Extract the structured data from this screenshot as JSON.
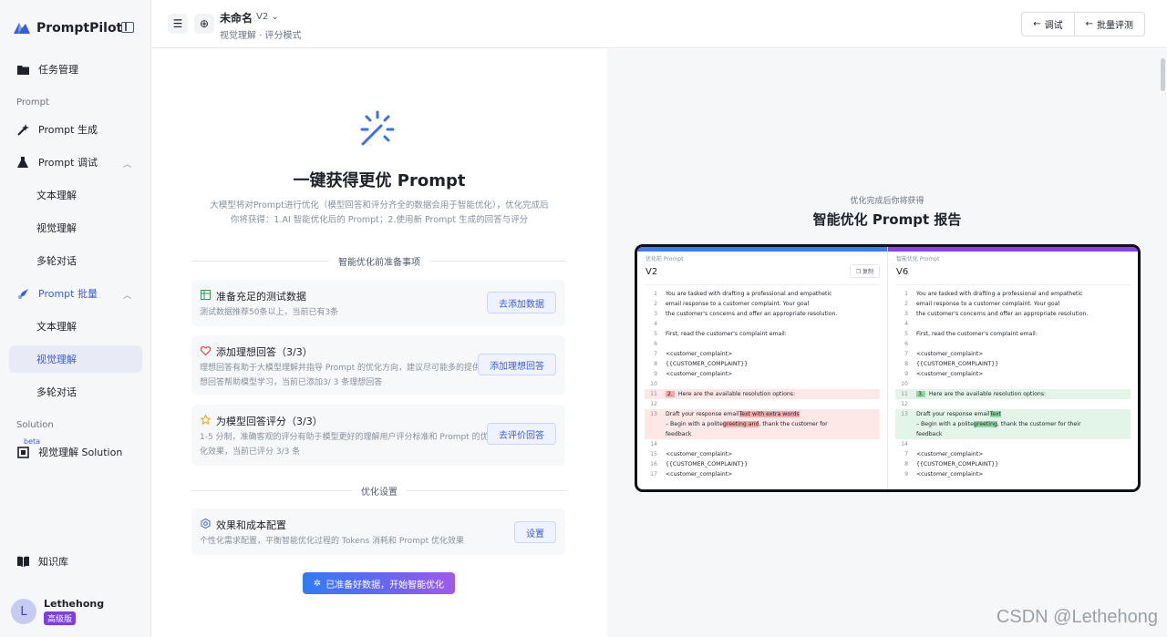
{
  "app": {
    "name": "PromptPilot"
  },
  "sidebar": {
    "task_mgmt": "任务管理",
    "section_prompt": "Prompt",
    "prompt_gen": "Prompt 生成",
    "prompt_debug": "Prompt 调试",
    "debug_subs": [
      "文本理解",
      "视觉理解",
      "多轮对话"
    ],
    "prompt_batch": "Prompt 批量",
    "batch_subs": [
      "文本理解",
      "视觉理解",
      "多轮对话"
    ],
    "section_solution": "Solution",
    "beta": "beta",
    "vision_solution": "视觉理解 Solution",
    "knowledge": "知识库",
    "user": {
      "initial": "L",
      "name": "Lethehong",
      "tier": "高级版"
    }
  },
  "header": {
    "title": "未命名",
    "version": "V2 ⌄",
    "breadcrumb_a": "视觉理解",
    "breadcrumb_sep": " · ",
    "breadcrumb_b": "评分模式",
    "debug_btn": "调试",
    "batch_eval_btn": "批量评测"
  },
  "left": {
    "title": "一键获得更优 Prompt",
    "desc": "大模型将对Prompt进行优化（模型回答和评分齐全的数据会用于智能优化），优化完成后你将获得：1.AI 智能优化后的 Prompt；2.使用新 Prompt 生成的回答与评分",
    "prep_label": "智能优化前准备事项",
    "cards": [
      {
        "title": "准备充足的测试数据",
        "desc": "测试数据推荐50条以上，当前已有3条",
        "btn": "去添加数据"
      },
      {
        "title": "添加理想回答（3/3）",
        "desc": "理想回答有助于大模型理解并指导 Prompt 的优化方向，建议尽可能多的提供理想回答帮助模型学习，当前已添加3/ 3 条理想回答",
        "btn": "添加理想回答"
      },
      {
        "title": "为模型回答评分（3/3）",
        "desc": "1-5 分制，准确客观的评分有助于模型更好的理解用户评分标准和 Prompt 的优化效果，当前已评分 3/3 条",
        "btn": "去评价回答"
      }
    ],
    "opt_label": "优化设置",
    "config": {
      "title": "效果和成本配置",
      "desc": "个性化需求配置，平衡智能优化过程的 Tokens 消耗和 Prompt 优化效果",
      "btn": "设置"
    },
    "start_btn": "已准备好数据，开始智能优化"
  },
  "right": {
    "subtitle": "优化完成后你将获得",
    "title": "智能优化 Prompt 报告",
    "left_pane": {
      "head": "优化前 Prompt",
      "version": "V2",
      "copy": "复制"
    },
    "right_pane": {
      "head": "智能优化 Prompt",
      "version": "V6"
    },
    "left_lines": [
      {
        "n": "1",
        "t": "You are tasked with drafting a professional and empathetic"
      },
      {
        "n": "2",
        "t": "email response to a customer complaint. Your goal"
      },
      {
        "n": "3",
        "t": "the customer's concerns and offer an appropriate resolution."
      },
      {
        "n": "4",
        "t": ""
      },
      {
        "n": "5",
        "t": "First, read the customer's complaint email:"
      },
      {
        "n": "6",
        "t": ""
      },
      {
        "n": "7",
        "t": "<customer_complaint>"
      },
      {
        "n": "8",
        "t": "{{CUSTOMER_COMPLAINT}}"
      },
      {
        "n": "9",
        "t": "<customer_complaint>"
      },
      {
        "n": "10",
        "t": ""
      },
      {
        "n": "11",
        "mark": "2.",
        "t": "Here are the available resolution options:",
        "cls": "del"
      },
      {
        "n": "12",
        "t": ""
      },
      {
        "n": "13",
        "pre": "Draft your response email",
        "hl": "Text with extra words",
        "post": "",
        "cls": "del"
      },
      {
        "n": "",
        "pre": "– Begin with a polite",
        "hl": "greeting and",
        "post": ", thank the customer for",
        "cls": "del"
      },
      {
        "n": "",
        "t": "feedback",
        "cls": "del"
      },
      {
        "n": "14",
        "t": ""
      },
      {
        "n": "15",
        "t": "<customer_complaint>"
      },
      {
        "n": "16",
        "t": "{{CUSTOMER_COMPLAINT}}"
      },
      {
        "n": "17",
        "t": "<customer_complaint>"
      }
    ],
    "right_lines": [
      {
        "n": "1",
        "t": "You are tasked with drafting a professional and empathetic"
      },
      {
        "n": "2",
        "t": "email response to a customer complaint. Your goal"
      },
      {
        "n": "3",
        "t": "the customer's concerns and offer an appropriate resolution."
      },
      {
        "n": "4",
        "t": ""
      },
      {
        "n": "5",
        "t": "First, read the customer's complaint email:"
      },
      {
        "n": "6",
        "t": ""
      },
      {
        "n": "7",
        "t": "<customer_complaint>"
      },
      {
        "n": "8",
        "t": "{{CUSTOMER_COMPLAINT}}"
      },
      {
        "n": "9",
        "t": "<customer_complaint>"
      },
      {
        "n": "10",
        "t": ""
      },
      {
        "n": "11",
        "mark": "3.",
        "t": "Here are the available resolution options:",
        "cls": "add"
      },
      {
        "n": "12",
        "t": ""
      },
      {
        "n": "13",
        "pre": "Draft your response email",
        "hl": "Text",
        "post": "",
        "cls": "add"
      },
      {
        "n": "",
        "pre": "– Begin with a polite",
        "hl": "greeting",
        "post": ", thank the customer for their",
        "cls": "add"
      },
      {
        "n": "",
        "t": "feedback",
        "cls": "add"
      },
      {
        "n": "14",
        "t": ""
      },
      {
        "n": "7",
        "t": "<customer_complaint>"
      },
      {
        "n": "8",
        "t": "{{CUSTOMER_COMPLAINT}}"
      },
      {
        "n": "9",
        "t": "<customer_complaint>"
      }
    ]
  },
  "watermark": "CSDN @Lethehong",
  "colors": {
    "accent": "#3b5bdb",
    "tier": "#7b3fe4",
    "diff_del": "#fde7e7",
    "diff_add": "#e3f5e8"
  }
}
